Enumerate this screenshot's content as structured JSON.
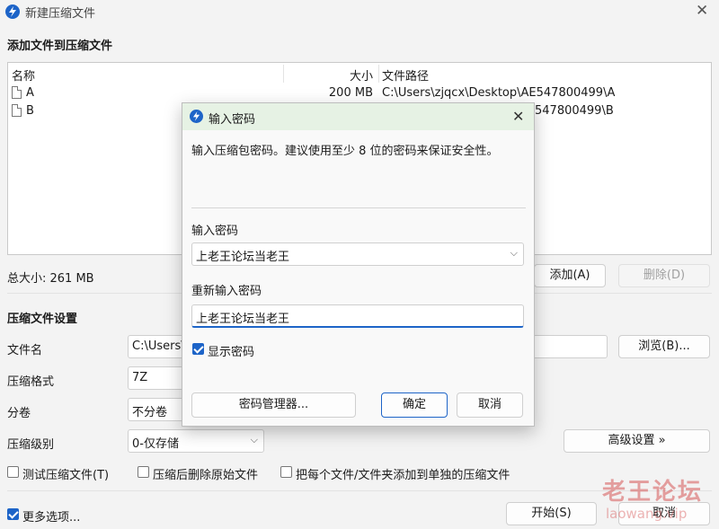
{
  "window": {
    "title": "新建压缩文件"
  },
  "add_section": {
    "title": "添加文件到压缩文件"
  },
  "file_list": {
    "columns": {
      "name": "名称",
      "size": "大小",
      "path": "文件路径"
    },
    "rows": [
      {
        "name": "A",
        "size": "200 MB",
        "path": "C:\\Users\\zjqcx\\Desktop\\AE547800499\\A"
      },
      {
        "name": "B",
        "size": "",
        "path": "C:\\Users\\zjqcx\\Desktop\\AE547800499\\B"
      }
    ],
    "row_b_path_visible": "547800499\\B"
  },
  "total_size": "总大小: 261 MB",
  "add_button": "添加(A)",
  "delete_button": "删除(D)",
  "settings_section": {
    "title": "压缩文件设置"
  },
  "filename": {
    "label": "文件名",
    "value": "C:\\Users\\"
  },
  "browse_button": "浏览(B)...",
  "format": {
    "label": "压缩格式",
    "value": "7Z"
  },
  "split": {
    "label": "分卷",
    "value": "不分卷"
  },
  "level": {
    "label": "压缩级别",
    "value": "0-仅存储"
  },
  "advanced_button": "高级设置 »",
  "options": {
    "test": "测试压缩文件(T)",
    "delete_after": "压缩后删除原始文件",
    "separate": "把每个文件/文件夹添加到单独的压缩文件"
  },
  "more_options": "更多选项...",
  "start_button": "开始(S)",
  "cancel_button": "取消",
  "watermark": {
    "main": "老王论坛",
    "sub": "laowang.vip"
  },
  "password_dialog": {
    "title": "输入密码",
    "description": "输入压缩包密码。建议使用至少 8 位的密码来保证安全性。",
    "password_label": "输入密码",
    "password_value": "上老王论坛当老王",
    "confirm_label": "重新输入密码",
    "confirm_value": "上老王论坛当老王",
    "show_password": "显示密码",
    "manager_button": "密码管理器...",
    "ok_button": "确定",
    "cancel_button": "取消"
  },
  "colors": {
    "accent": "#1d64c8",
    "dialog_header": "#e6f2e4",
    "watermark": "#d65656"
  }
}
